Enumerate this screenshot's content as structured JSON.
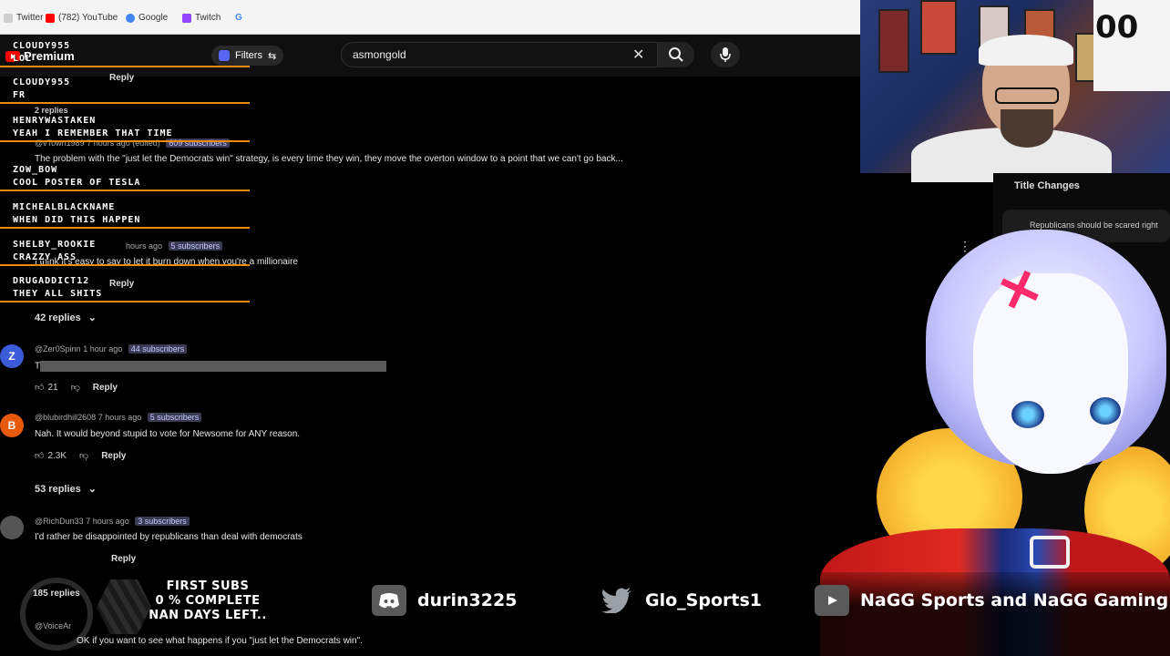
{
  "bookmarks": [
    {
      "label": "Twitter",
      "color": "#cfcfcf"
    },
    {
      "label": "(782) YouTube",
      "color": "#ff0000"
    },
    {
      "label": "Google",
      "color": "#4285f4"
    },
    {
      "label": "Twitch",
      "color": "#9146ff"
    },
    {
      "label": "G",
      "color": "#4285f4"
    }
  ],
  "youtube": {
    "logo_text": "Premium",
    "filters_label": "Filters",
    "search_value": "asmongold"
  },
  "chat": [
    {
      "user": "cloudy955",
      "text": "LOL"
    },
    {
      "user": "cloudy955",
      "text": "FR"
    },
    {
      "user": "Henrywastaken",
      "text": "Yeah I remember that time"
    },
    {
      "user": "zow_bow",
      "text": "cool poster of tesla"
    },
    {
      "user": "MichealBlackName",
      "text": "when did this happen"
    },
    {
      "user": "shelby_rookie",
      "text": "crazzy ass"
    },
    {
      "user": "drugaddict12",
      "text": "they all shits"
    }
  ],
  "comments": {
    "c1_reply": "Reply",
    "c1_replies": "2 replies",
    "c2_user": "@vTown1989",
    "c2_time": "7 hours ago (edited)",
    "c2_subs": "609 subscribers",
    "c2_text": "The problem with the \"just let the Democrats win\" strategy, is every time they win, they move the overton window to a point that we can't go back...",
    "c3_text": "I think it's easy to say to let it burn down when you're a millionaire",
    "c3_time": "hours ago",
    "c3_subs": "5 subscribers",
    "c3_reply": "Reply",
    "c3_replies": "42 replies",
    "c4_avatar": "Z",
    "c4_user": "@Zer0Spinn",
    "c4_time": "1 hour ago",
    "c4_subs": "44 subscribers",
    "c4_text": "T",
    "c4_likes": "21",
    "c4_reply": "Reply",
    "c5_avatar": "B",
    "c5_user": "@blubirdhill2608",
    "c5_time": "7 hours ago",
    "c5_subs": "5 subscribers",
    "c5_text": "Nah. It would beyond stupid to vote for Newsome for ANY reason.",
    "c5_likes": "2.3K",
    "c5_reply": "Reply",
    "c5_replies": "53 replies",
    "c6_user": "@RichDun33",
    "c6_time": "7 hours ago",
    "c6_subs": "3 subscribers",
    "c6_text": "I'd rather be disappointed by republicans than deal with democrats",
    "c6_reply": "Reply",
    "c6_replies": "185 replies",
    "c7_user": "@VoiceAr",
    "c7_text": "OK if you want to see what happens if you \"just let the Democrats win\"."
  },
  "side_panel": {
    "title": "Title Changes",
    "card_text": "Republicans should be scared right"
  },
  "overlay": {
    "goal_line1": "FIRST SUBS",
    "goal_line2": "0 % COMPLETE",
    "goal_line3": "NAN DAYS LEFT..",
    "discord": "durin3225",
    "twitter": "Glo_Sports1",
    "youtube": "NaGG Sports and NaGG Gaming"
  },
  "webcam": {
    "jersey_number": "00"
  },
  "colors": {
    "chat_underline": "#f08a00",
    "yt_red": "#ff0000",
    "avatar_z": "#3b5bdb",
    "avatar_b": "#e8590c"
  }
}
